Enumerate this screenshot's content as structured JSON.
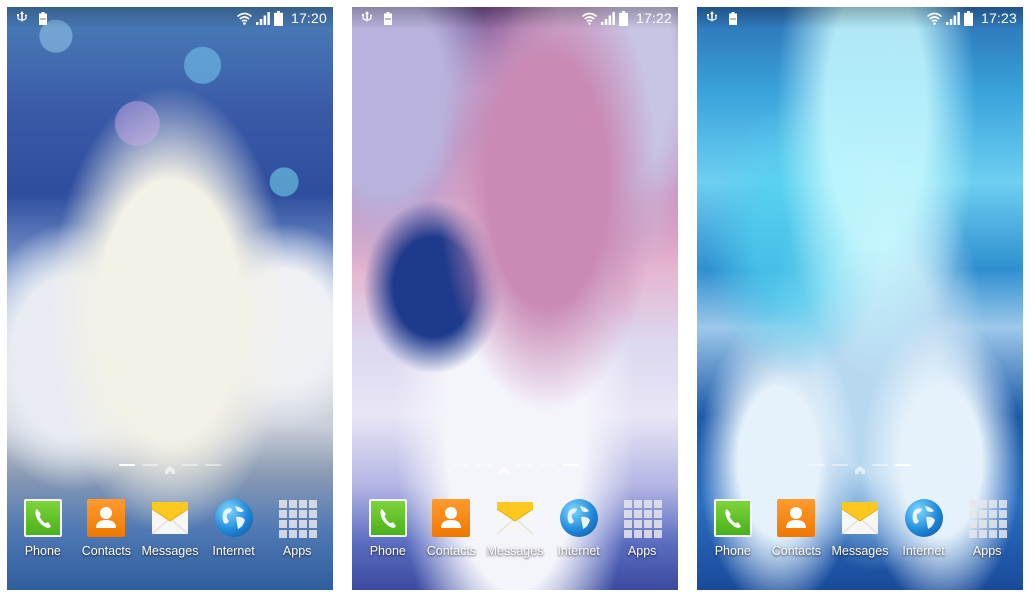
{
  "screens": [
    {
      "wallpaper": "frosty trees with bokeh and snowflakes",
      "status": {
        "time": "17:20"
      },
      "page_indicator": {
        "pages": [
          "dash",
          "dash",
          "home",
          "dash",
          "dash"
        ],
        "active": 0
      },
      "dock": [
        {
          "label": "Phone",
          "icon": "phone-icon"
        },
        {
          "label": "Contacts",
          "icon": "contacts-icon"
        },
        {
          "label": "Messages",
          "icon": "messages-icon"
        },
        {
          "label": "Internet",
          "icon": "internet-globe-icon"
        },
        {
          "label": "Apps",
          "icon": "apps-grid-icon"
        }
      ]
    },
    {
      "wallpaper": "frost-framed pink winter landscape",
      "status": {
        "time": "17:22"
      },
      "page_indicator": {
        "pages": [
          "dash",
          "dash",
          "home",
          "dash",
          "dash",
          "dash"
        ],
        "active": 5
      },
      "dock": [
        {
          "label": "Phone",
          "icon": "phone-icon"
        },
        {
          "label": "Contacts",
          "icon": "contacts-icon"
        },
        {
          "label": "Messages",
          "icon": "messages-icon"
        },
        {
          "label": "Internet",
          "icon": "internet-globe-icon"
        },
        {
          "label": "Apps",
          "icon": "apps-grid-icon"
        }
      ]
    },
    {
      "wallpaper": "aurora over snowy fir trees",
      "status": {
        "time": "17:23"
      },
      "page_indicator": {
        "pages": [
          "dash",
          "dash",
          "home",
          "dash",
          "dash"
        ],
        "active": 4
      },
      "dock": [
        {
          "label": "Phone",
          "icon": "phone-icon"
        },
        {
          "label": "Contacts",
          "icon": "contacts-icon"
        },
        {
          "label": "Messages",
          "icon": "messages-icon"
        },
        {
          "label": "Internet",
          "icon": "internet-globe-icon"
        },
        {
          "label": "Apps",
          "icon": "apps-grid-icon"
        }
      ]
    }
  ],
  "colors": {
    "phone_green": "#5cc024",
    "contacts_orange": "#f88a14",
    "messages_yellow": "#ffc81e",
    "internet_blue": "#1f88d8",
    "label_text": "#ffffff"
  }
}
